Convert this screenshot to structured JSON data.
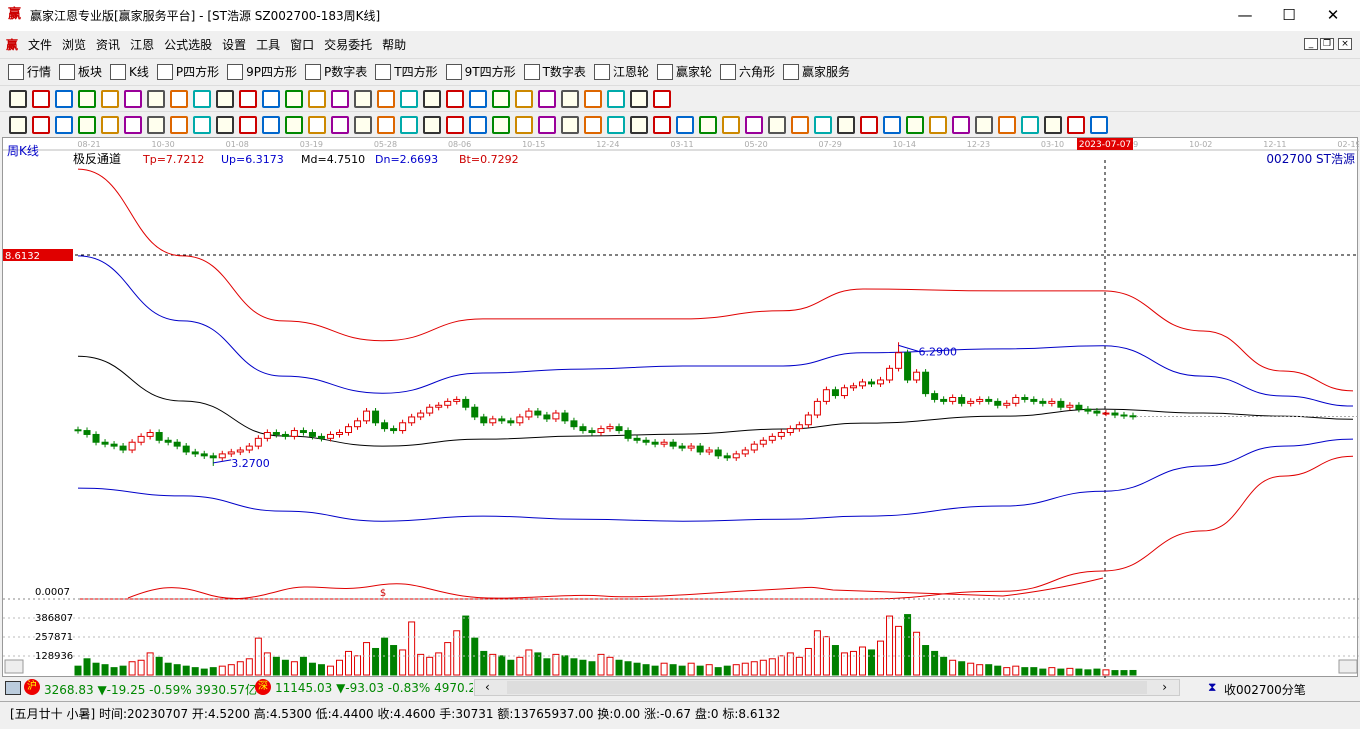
{
  "window": {
    "title": "赢家江恩专业版[赢家服务平台] - [ST浩源  SZ002700-183周K线]",
    "min": "—",
    "max": "☐",
    "close": "✕"
  },
  "menu": [
    "文件",
    "浏览",
    "资讯",
    "江恩",
    "公式选股",
    "设置",
    "工具",
    "窗口",
    "交易委托",
    "帮助"
  ],
  "toolbar1": [
    {
      "label": "行情",
      "icon": "grid-icon"
    },
    {
      "label": "板块",
      "icon": "blocks-icon"
    },
    {
      "label": "K线",
      "icon": "candles-icon"
    },
    {
      "label": "P四方形",
      "icon": "p-square-icon"
    },
    {
      "label": "9P四方形",
      "icon": "9p-square-icon"
    },
    {
      "label": "P数字表",
      "icon": "p-number-icon"
    },
    {
      "label": "T四方形",
      "icon": "t-square-icon"
    },
    {
      "label": "9T四方形",
      "icon": "9t-square-icon"
    },
    {
      "label": "T数字表",
      "icon": "t-number-icon"
    },
    {
      "label": "江恩轮",
      "icon": "gann-wheel-icon"
    },
    {
      "label": "赢家轮",
      "icon": "winner-wheel-icon"
    },
    {
      "label": "六角形",
      "icon": "hexagon-icon"
    },
    {
      "label": "赢家服务",
      "icon": "dollar-icon"
    }
  ],
  "chart": {
    "period_label": "周K线",
    "indicator": "极反通道",
    "tp": "Tp=7.7212",
    "up": "Up=6.3173",
    "md": "Md=4.7510",
    "dn": "Dn=2.6693",
    "bt": "Bt=0.7292",
    "stock": "002700  ST浩源",
    "cursor_price": "8.6132",
    "cursor_date": "2023-07-07",
    "x_ticks": [
      "08-21",
      "10-30",
      "01-08",
      "03-19",
      "05-28",
      "08-06",
      "10-15",
      "12-24",
      "03-11",
      "05-20",
      "07-29",
      "10-14",
      "12-23",
      "03-10",
      "05-19",
      "10-02",
      "12-11",
      "02-19"
    ],
    "high_label": "6.2900",
    "low_label": "3.2700",
    "osc_label": "0.0007",
    "osc_mark": "$",
    "vol_ticks": [
      "386807",
      "257871",
      "128936"
    ]
  },
  "colors": {
    "up": "#e00000",
    "down": "#008000",
    "upper_outer": "#e00000",
    "upper_inner": "#0000c8",
    "mid": "#000000"
  },
  "chart_data": {
    "type": "candlestick",
    "closes": [
      4.1,
      4.0,
      3.8,
      3.75,
      3.7,
      3.6,
      3.8,
      3.95,
      4.05,
      3.85,
      3.8,
      3.7,
      3.55,
      3.5,
      3.45,
      3.4,
      3.5,
      3.55,
      3.6,
      3.7,
      3.9,
      4.05,
      4.0,
      3.95,
      4.1,
      4.05,
      3.95,
      3.9,
      4.0,
      4.05,
      4.2,
      4.35,
      4.6,
      4.3,
      4.15,
      4.1,
      4.3,
      4.45,
      4.55,
      4.7,
      4.75,
      4.85,
      4.9,
      4.7,
      4.45,
      4.3,
      4.4,
      4.35,
      4.3,
      4.45,
      4.6,
      4.5,
      4.4,
      4.55,
      4.35,
      4.2,
      4.1,
      4.05,
      4.15,
      4.2,
      4.1,
      3.9,
      3.85,
      3.8,
      3.75,
      3.8,
      3.7,
      3.65,
      3.7,
      3.55,
      3.6,
      3.45,
      3.4,
      3.5,
      3.6,
      3.75,
      3.85,
      3.95,
      4.05,
      4.15,
      4.25,
      4.5,
      4.85,
      5.15,
      5.0,
      5.2,
      5.25,
      5.35,
      5.3,
      5.4,
      5.7,
      6.1,
      5.4,
      5.6,
      5.05,
      4.9,
      4.85,
      4.95,
      4.8,
      4.85,
      4.9,
      4.85,
      4.75,
      4.8,
      4.95,
      4.9,
      4.85,
      4.8,
      4.85,
      4.7,
      4.75,
      4.65,
      4.6,
      4.55,
      4.55,
      4.5,
      4.48,
      4.46
    ],
    "volumes": [
      60000,
      110000,
      80000,
      70000,
      50000,
      60000,
      90000,
      100000,
      150000,
      120000,
      80000,
      70000,
      60000,
      50000,
      40000,
      50000,
      60000,
      70000,
      90000,
      110000,
      250000,
      150000,
      120000,
      100000,
      90000,
      120000,
      80000,
      70000,
      60000,
      100000,
      160000,
      130000,
      220000,
      180000,
      250000,
      200000,
      170000,
      360000,
      140000,
      120000,
      150000,
      220000,
      300000,
      400000,
      250000,
      160000,
      140000,
      130000,
      100000,
      120000,
      170000,
      150000,
      110000,
      140000,
      130000,
      110000,
      100000,
      90000,
      140000,
      120000,
      100000,
      90000,
      80000,
      70000,
      60000,
      80000,
      70000,
      60000,
      80000,
      60000,
      70000,
      50000,
      60000,
      70000,
      80000,
      90000,
      100000,
      110000,
      130000,
      150000,
      120000,
      180000,
      300000,
      260000,
      200000,
      150000,
      160000,
      190000,
      170000,
      230000,
      400000,
      330000,
      410000,
      290000,
      200000,
      160000,
      120000,
      100000,
      90000,
      80000,
      70000,
      70000,
      60000,
      50000,
      60000,
      50000,
      50000,
      40000,
      50000,
      40000,
      45000,
      40000,
      35000,
      40000,
      35000,
      30000,
      30000,
      30731
    ],
    "bands": {
      "upper_outer": [
        10.82,
        8.59,
        6.92,
        6.41,
        6.97,
        6.97,
        6.97,
        7.18,
        7.74,
        7.69,
        7.69,
        6.66,
        5.63,
        5.12
      ],
      "upper_inner": [
        8.59,
        6.92,
        5.5,
        5.06,
        5.58,
        5.68,
        5.76,
        5.76,
        6.1,
        6.2,
        6.28,
        5.5,
        4.99,
        4.73
      ],
      "mid": [
        6.01,
        4.86,
        3.96,
        3.7,
        3.88,
        3.96,
        4.01,
        4.14,
        4.29,
        4.47,
        4.65,
        4.55,
        4.47,
        4.39
      ],
      "lower_inner": [
        2.62,
        2.42,
        2.03,
        1.77,
        1.9,
        1.82,
        1.77,
        1.82,
        1.9,
        2.16,
        2.54,
        3.19,
        3.7,
        3.88
      ],
      "lower_outer": [
        -0.28,
        -0.28,
        -0.28,
        -0.28,
        -0.28,
        -0.28,
        -0.28,
        -0.23,
        -0.23,
        -0.03,
        0.49,
        1.52,
        2.93,
        3.44
      ]
    }
  },
  "market": {
    "sh_badge": "沪",
    "sh": "3268.83 ▼-19.25 -0.59% 3930.57亿",
    "sz_badge": "深",
    "sz": "11145.03 ▼-93.03 -0.83% 4970.20",
    "watch": "收002700分笔"
  },
  "status": "[五月廿十 小暑] 时间:20230707 开:4.5200 高:4.5300 低:4.4400 收:4.4600 手:30731 额:13765937.00 换:0.00 涨:-0.67 盘:0 标:8.6132"
}
